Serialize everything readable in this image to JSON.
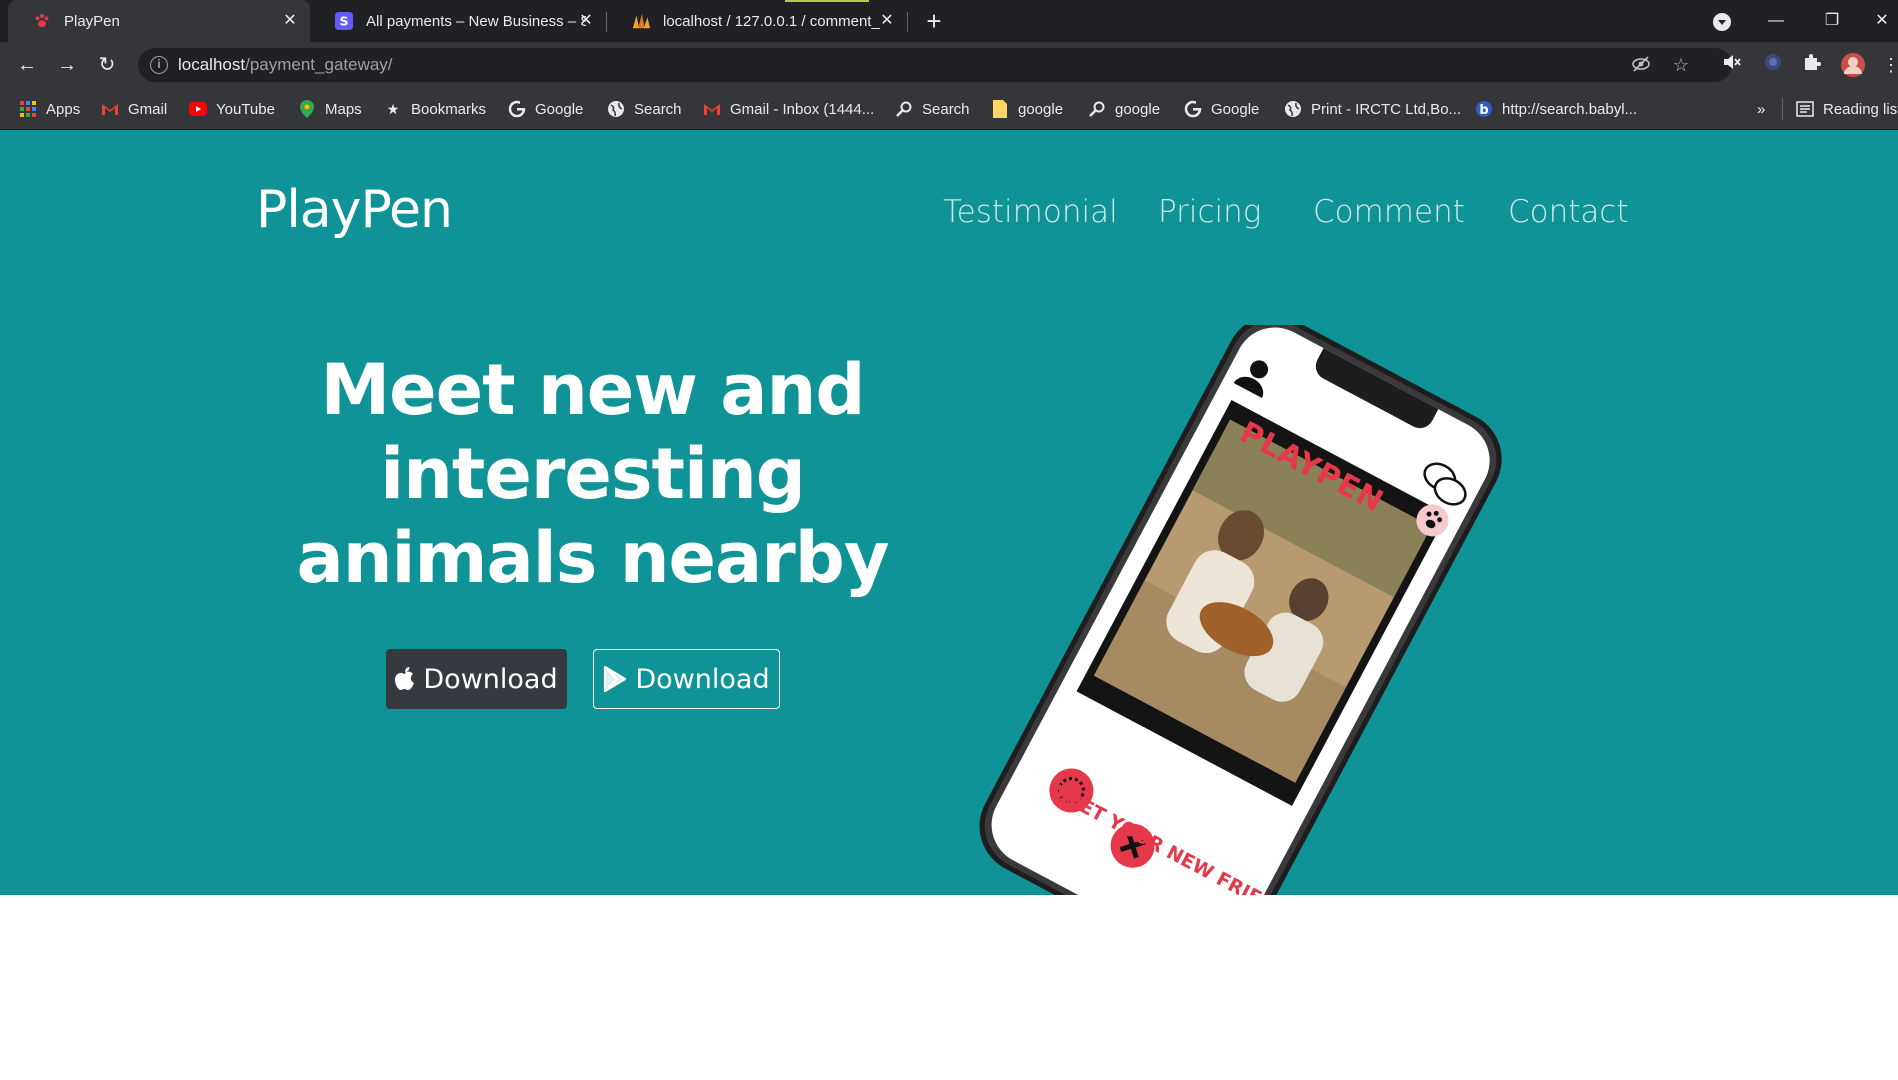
{
  "browser": {
    "tabs": [
      {
        "title": "PlayPen",
        "active": true
      },
      {
        "title": "All payments – New Business – St",
        "active": false
      },
      {
        "title": "localhost / 127.0.0.1 / comment_",
        "active": false
      }
    ],
    "address": {
      "host": "localhost",
      "path": "/payment_gateway/"
    },
    "bookmarks": [
      {
        "label": "Apps",
        "icon": "apps-grid-icon"
      },
      {
        "label": "Gmail",
        "icon": "gmail-icon"
      },
      {
        "label": "YouTube",
        "icon": "youtube-icon"
      },
      {
        "label": "Maps",
        "icon": "maps-icon"
      },
      {
        "label": "Bookmarks",
        "icon": "star-icon"
      },
      {
        "label": "Google",
        "icon": "google-icon"
      },
      {
        "label": "Search",
        "icon": "globe-icon"
      },
      {
        "label": "Gmail - Inbox (1444...",
        "icon": "gmail-icon"
      },
      {
        "label": "Search",
        "icon": "search-magnifier-icon"
      },
      {
        "label": "google",
        "icon": "folder-note-icon"
      },
      {
        "label": "google",
        "icon": "search-magnifier-icon"
      },
      {
        "label": "Google",
        "icon": "google-icon"
      },
      {
        "label": "Print - IRCTC Ltd,Bo...",
        "icon": "globe-icon"
      },
      {
        "label": "http://search.babyl...",
        "icon": "babylon-icon"
      }
    ],
    "overflow_label": "»",
    "reading_list": "Reading list"
  },
  "site": {
    "brand": "PlayPen",
    "nav": [
      "Testimonial",
      "Pricing",
      "Comment",
      "Contact"
    ],
    "headline": [
      "Meet new and",
      "interesting",
      "animals nearby"
    ],
    "buttons": {
      "apple_download": "Download",
      "play_download": "Download"
    },
    "phone": {
      "app_name": "PLAYPEN",
      "tagline": "MEET YOUR NEW FRIEND"
    }
  },
  "colors": {
    "hero_bg": "#0f9396",
    "dark_button": "#343a40",
    "app_red": "#e5384a"
  }
}
